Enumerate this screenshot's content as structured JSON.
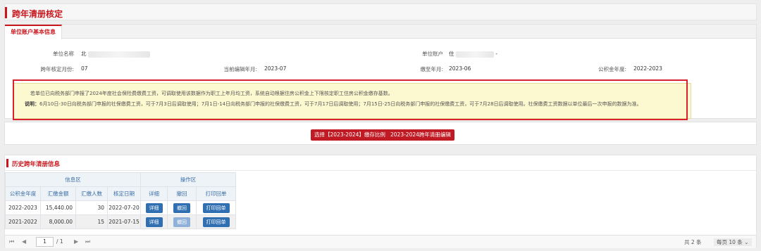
{
  "page_title": "跨年清册核定",
  "basic_info": {
    "tab_label": "单位账户基本信息",
    "unit_name_label": "单位名称",
    "unit_name_value": "北",
    "unit_account_label": "单位账户",
    "unit_account_value": "住",
    "unit_account_suffix": "-",
    "month_label": "跨年核定月份:",
    "month_value": "07",
    "edit_month_label": "当前编辑年月:",
    "edit_month_value": "2023-07",
    "paid_until_label": "缴至年月:",
    "paid_until_value": "2023-06",
    "fund_year_label": "公积金年度:",
    "fund_year_value": "2022-2023"
  },
  "notice": {
    "line1": "若单位已向税务部门申报了2024年度社会保险费缴费工资，可调取使用该数据作为职工上年月均工资，系统自动根据住房公积金上下限核定职工住房公积金缴存基数。",
    "line2_label": "说明：",
    "line2": "6月10日-30日向税务部门申报的社保缴费工资，可于7月3日后调取使用；7月1日-14日向税务部门申报的社保缴费工资，可于7月17日后调取使用；7月15日-25日向税务部门申报的社保缴费工资，可于7月28日后调取使用。社保缴费工资数据以单位最后一次申报的数据为准。"
  },
  "actions": {
    "select_ratio": "选择【2023-2024】缴存比例",
    "edit_register": "2023-2024跨年清册编辑"
  },
  "history": {
    "title": "历史跨年清册信息",
    "group_info": "信息区",
    "group_ops": "操作区",
    "columns": [
      "公积金年度",
      "汇缴金额",
      "汇缴人数",
      "核定日期",
      "详细",
      "撤回",
      "打印回单"
    ],
    "rows": [
      {
        "year": "2022-2023",
        "amount": "15,440.00",
        "count": "30",
        "date": "2022-07-20",
        "detail": "详细",
        "revoke": "撤回",
        "print": "打印回单"
      },
      {
        "year": "2021-2022",
        "amount": "8,000.00",
        "count": "15",
        "date": "2021-07-15",
        "detail": "详细",
        "revoke": "撤回",
        "print": "打印回单"
      }
    ]
  },
  "pager": {
    "current_page": "1",
    "total_pages": "/ 1",
    "total_text": "共 2 条",
    "per_page_text": "每页 10 条"
  },
  "colors": {
    "accent": "#c8161d",
    "button_red": "#c01b25",
    "button_blue": "#2f6fb2",
    "notice_bg": "#fcf8d0"
  }
}
